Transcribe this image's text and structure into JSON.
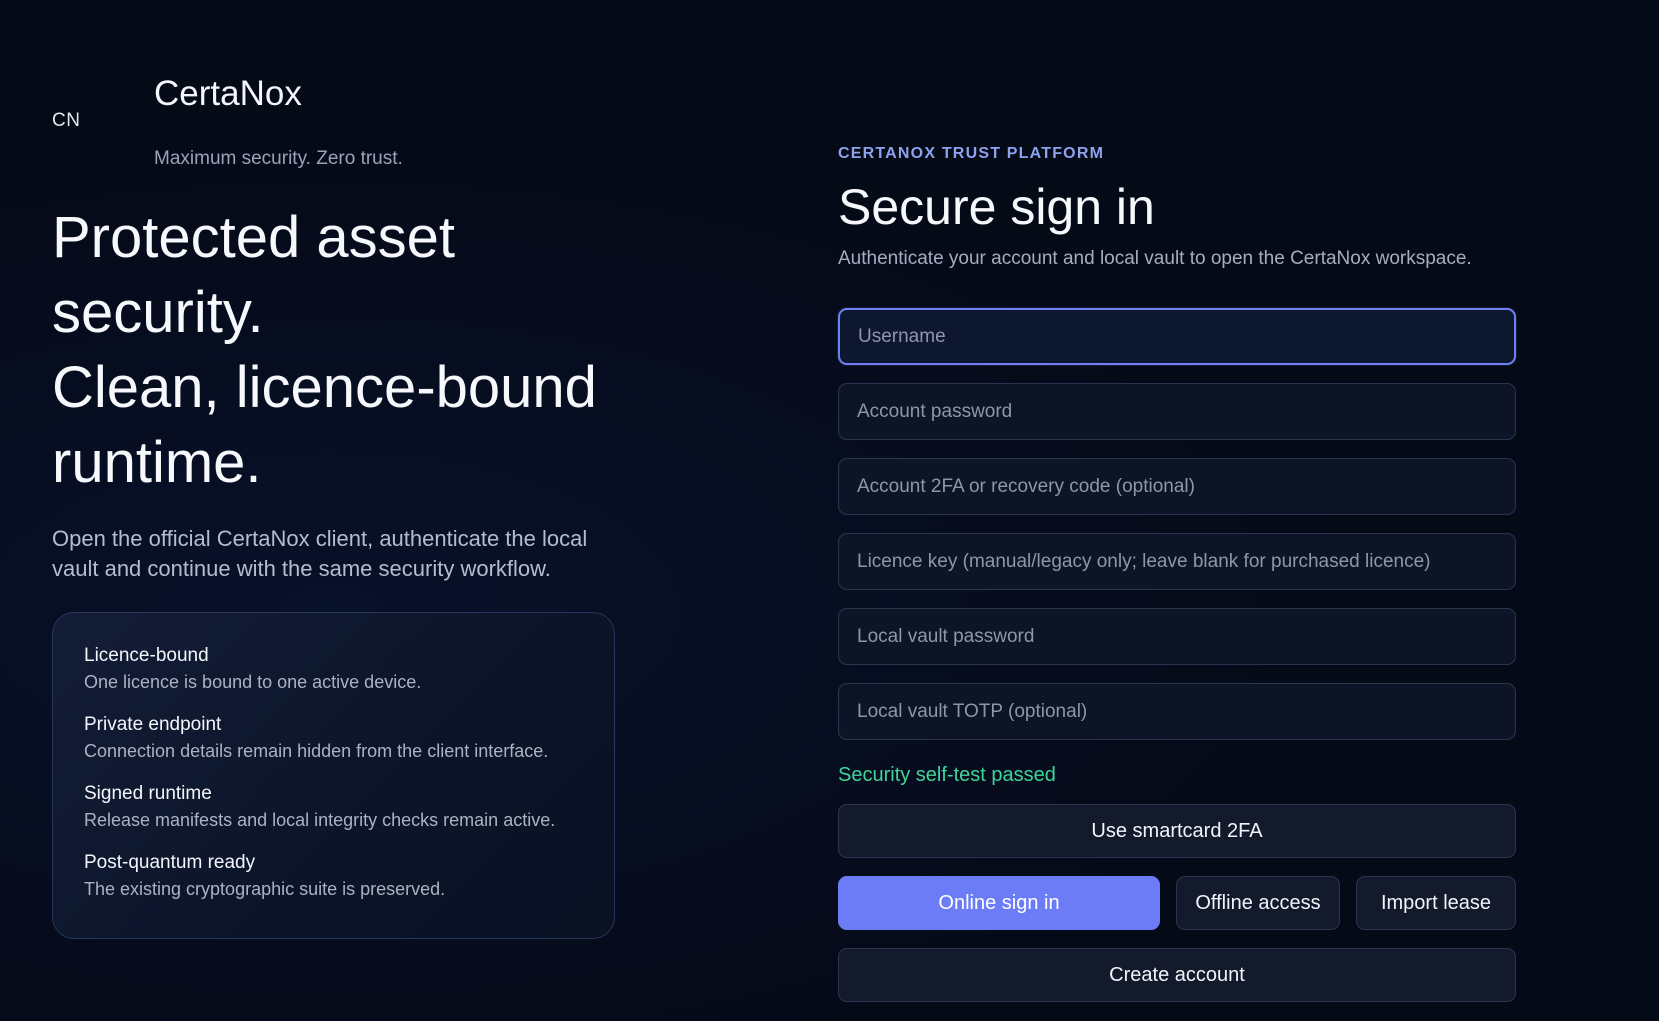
{
  "brand": {
    "mark": "CN",
    "name": "CertaNox",
    "tagline": "Maximum security. Zero trust."
  },
  "hero": {
    "lines": [
      "Protected asset",
      "security.",
      "Clean, licence-bound",
      "runtime."
    ],
    "subtitle": "Open the official CertaNox client, authenticate the local vault and continue with the same security workflow."
  },
  "features": [
    {
      "title": "Licence-bound",
      "desc": "One licence is bound to one active device."
    },
    {
      "title": "Private endpoint",
      "desc": "Connection details remain hidden from the client interface."
    },
    {
      "title": "Signed runtime",
      "desc": "Release manifests and local integrity checks remain active."
    },
    {
      "title": "Post-quantum ready",
      "desc": "The existing cryptographic suite is preserved."
    }
  ],
  "signin": {
    "eyebrow": "CERTANOX TRUST PLATFORM",
    "title": "Secure sign in",
    "subtitle": "Authenticate your account and local vault to open the CertaNox workspace.",
    "fields": {
      "username": {
        "placeholder": "Username",
        "value": ""
      },
      "password": {
        "placeholder": "Account password",
        "value": ""
      },
      "twofa": {
        "placeholder": "Account 2FA or recovery code (optional)",
        "value": ""
      },
      "licence": {
        "placeholder": "Licence key (manual/legacy only; leave blank for purchased licence)",
        "value": ""
      },
      "vault_password": {
        "placeholder": "Local vault password",
        "value": ""
      },
      "vault_totp": {
        "placeholder": "Local vault TOTP (optional)",
        "value": ""
      }
    },
    "status": "Security self-test passed",
    "buttons": {
      "smartcard": "Use smartcard 2FA",
      "online": "Online sign in",
      "offline": "Offline access",
      "import": "Import lease",
      "create": "Create account"
    }
  },
  "colors": {
    "background": "#050a17",
    "accent": "#6c7cf7",
    "success": "#3fd59a",
    "eyebrow": "#8ea2f0"
  }
}
